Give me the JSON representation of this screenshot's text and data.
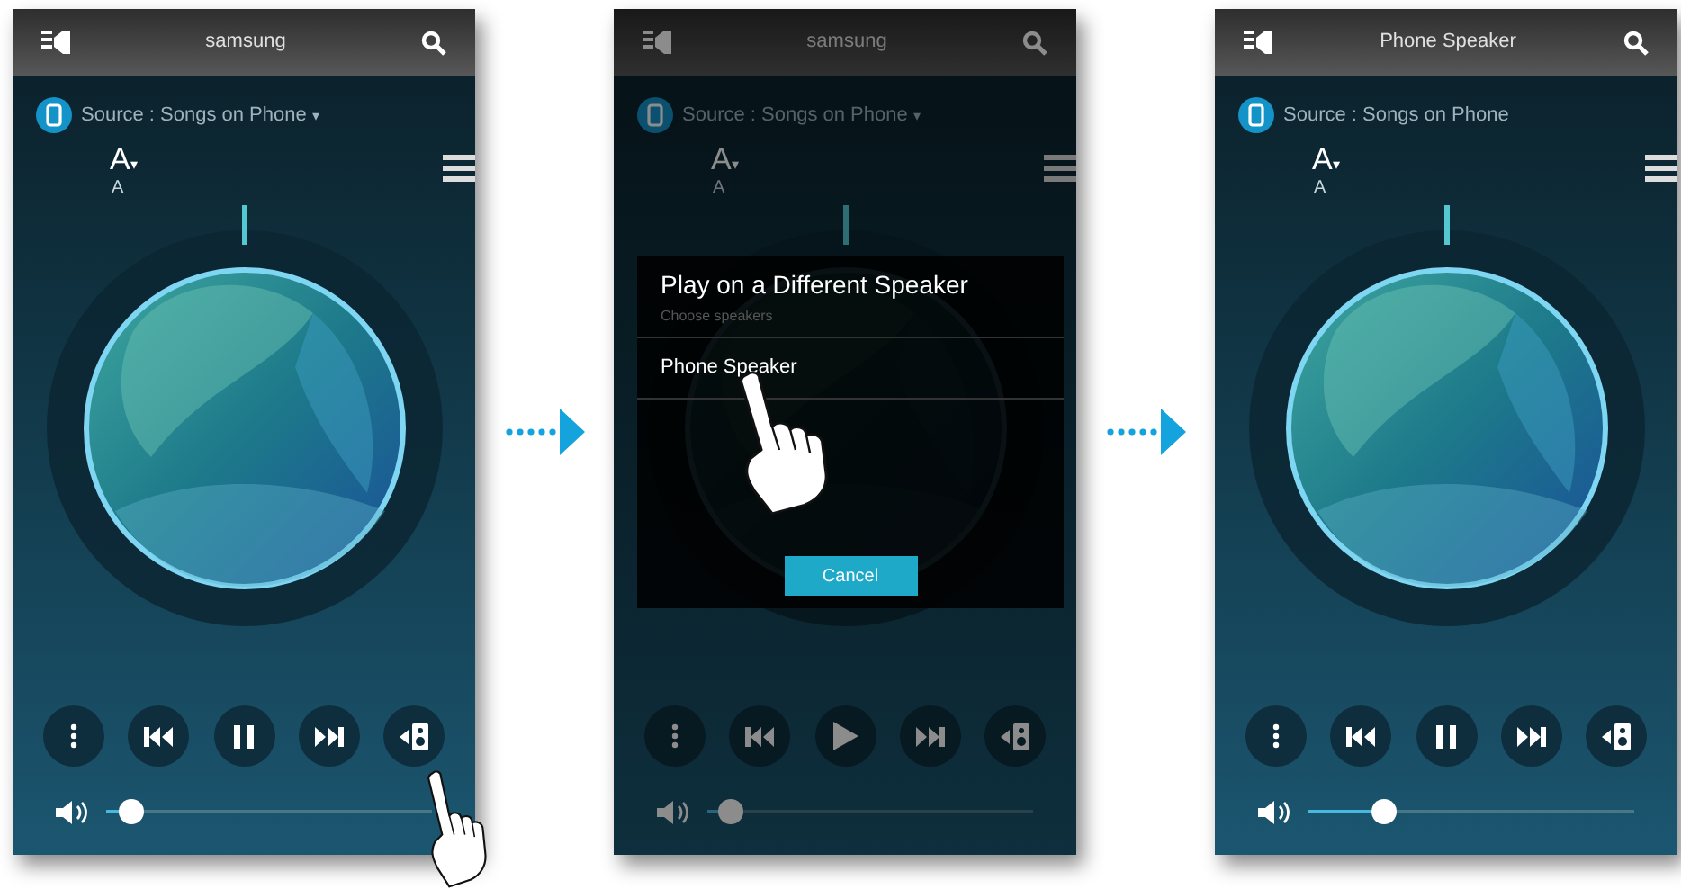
{
  "screens": [
    {
      "title": "samsung",
      "source": "Source : Songs on Phone",
      "source_caret": "▾",
      "font_label": "A",
      "font_caret": "▾",
      "font_sub": "A",
      "playing": true,
      "speaker_tapped": true,
      "volume": {
        "level": 0.08
      }
    },
    {
      "title": "samsung",
      "source": "Source : Songs on Phone",
      "source_caret": "▾",
      "font_label": "A",
      "font_caret": "▾",
      "font_sub": "A",
      "dimmed": true,
      "playing": false,
      "speaker_tapped": false,
      "volume": {
        "level": 0.07
      },
      "dialog": {
        "title": "Play on a Different Speaker",
        "subtitle": "Choose speakers",
        "options": [
          {
            "label": "Phone Speaker",
            "tapped": true
          }
        ],
        "cancel": "Cancel"
      }
    },
    {
      "title": "Phone Speaker",
      "source": "Source : Songs on Phone",
      "font_label": "A",
      "font_caret": "▾",
      "font_sub": "A",
      "playing": true,
      "speaker_tapped": false,
      "volume": {
        "level": 0.23
      }
    }
  ]
}
